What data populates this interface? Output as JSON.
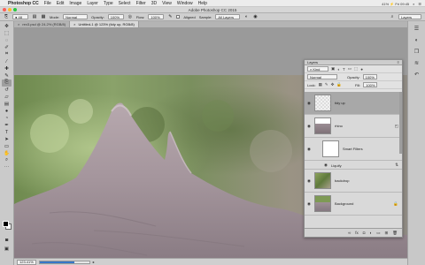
{
  "menubar": {
    "items": [
      "Photoshop CC",
      "File",
      "Edit",
      "Image",
      "Layer",
      "Type",
      "Select",
      "Filter",
      "3D",
      "View",
      "Window",
      "Help"
    ],
    "status": "41% ⚡ Fri 09:45"
  },
  "window": {
    "title": "Adobe Photoshop CC 2015"
  },
  "options": {
    "mode_label": "Mode:",
    "mode_value": "Normal",
    "opacity_label": "Opacity:",
    "opacity_value": "100%",
    "flow_label": "Flow:",
    "flow_value": "100%",
    "aligned_label": "Aligned",
    "sample_label": "Sample:",
    "sample_value": "All Layers",
    "workspace_value": "Layers"
  },
  "tabs": [
    {
      "label": "rex3.psd @ 24.2% (RGB/8)",
      "close": "×"
    },
    {
      "label": "Untitled-1 @ 123% (tidy up, RGB/8)",
      "close": "×"
    }
  ],
  "status": {
    "zoom": "123.41%",
    "progress": 0.7
  },
  "layers": {
    "panel_title": "Layers",
    "kind_label": "Kind",
    "blend_mode": "Normal",
    "opacity_label": "Opacity:",
    "opacity_value": "100%",
    "lock_label": "Lock:",
    "fill_label": "Fill:",
    "fill_value": "100%",
    "items": [
      {
        "name": "tidy up",
        "selected": true
      },
      {
        "name": "rhino",
        "selected": false
      },
      {
        "name": "Smart Filters",
        "selected": false
      },
      {
        "name": "Liquify",
        "selected": false
      },
      {
        "name": "backdrop",
        "selected": false
      },
      {
        "name": "Background",
        "selected": false
      }
    ]
  },
  "icons": {
    "tools": [
      "move-icon",
      "marquee-icon",
      "lasso-icon",
      "quick-select-icon",
      "crop-icon",
      "eyedropper-icon",
      "healing-icon",
      "brush-icon",
      "clone-stamp-icon",
      "history-brush-icon",
      "eraser-icon",
      "gradient-icon",
      "blur-icon",
      "dodge-icon",
      "pen-icon",
      "type-icon",
      "path-select-icon",
      "shape-icon",
      "hand-icon",
      "zoom-icon"
    ],
    "dock": [
      "properties-icon",
      "adjustments-icon",
      "layers-icon",
      "channels-icon",
      "history-icon"
    ]
  },
  "colors": {
    "accent": "#3777c7",
    "selection": "#a8a8a8"
  }
}
